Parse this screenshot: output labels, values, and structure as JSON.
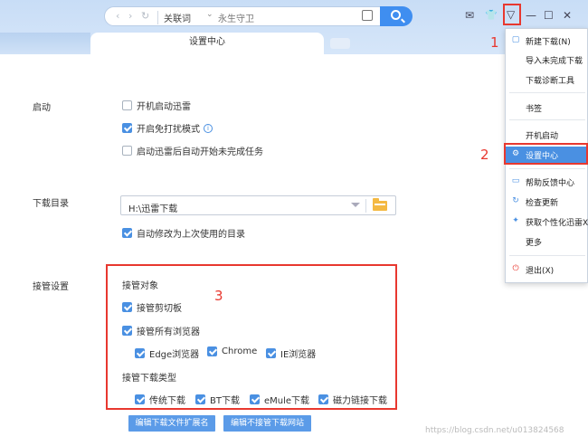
{
  "titlebar": {
    "search_label": "关联词",
    "search_value": "永生守卫",
    "back_icon": "‹",
    "forward_icon": "›",
    "refresh_icon": "↻",
    "dropdown_icon": "⌄",
    "mail_icon": "✉",
    "skin_icon": "👕",
    "menu_icon": "▽",
    "minimize_icon": "—",
    "maximize_icon": "☐",
    "close_icon": "✕"
  },
  "tabs": {
    "active": "设置中心"
  },
  "annotations": {
    "n1": "1",
    "n2": "2",
    "n3": "3"
  },
  "settings": {
    "startup": {
      "label": "启动",
      "options": [
        {
          "text": "开机启动迅雷",
          "checked": false
        },
        {
          "text": "开启免打扰模式",
          "checked": true
        },
        {
          "text": "启动迅雷后自动开始未完成任务",
          "checked": false
        }
      ],
      "info_icon": "i"
    },
    "download_dir": {
      "label": "下载目录",
      "path": "H:\\迅雷下载",
      "auto_modify": {
        "text": "自动修改为上次使用的目录",
        "checked": true
      }
    },
    "takeover": {
      "label": "接管设置",
      "objects_title": "接管对象",
      "clipboard": {
        "text": "接管剪切板",
        "checked": true
      },
      "all_browsers": {
        "text": "接管所有浏览器",
        "checked": true
      },
      "browsers": [
        {
          "text": "Edge浏览器",
          "checked": true
        },
        {
          "text": "Chrome",
          "checked": true
        },
        {
          "text": "IE浏览器",
          "checked": true
        }
      ],
      "types_title": "接管下载类型",
      "types": [
        {
          "text": "传统下载",
          "checked": true
        },
        {
          "text": "BT下载",
          "checked": true
        },
        {
          "text": "eMule下载",
          "checked": true
        },
        {
          "text": "磁力链接下载",
          "checked": true
        }
      ],
      "btn_edit_ext": "编辑下载文件扩展名",
      "btn_edit_sites": "编辑不接管下载网站"
    }
  },
  "menu": {
    "items": [
      {
        "label": "新建下载(N)",
        "icon": "doc-plus-icon",
        "glyph": "▢"
      },
      {
        "label": "导入未完成下载",
        "icon": "",
        "glyph": ""
      },
      {
        "label": "下载诊断工具",
        "icon": "",
        "glyph": ""
      },
      {
        "label": "书签",
        "icon": "",
        "glyph": ""
      },
      {
        "label": "开机启动",
        "icon": "",
        "glyph": ""
      },
      {
        "label": "设置中心",
        "icon": "gear-icon",
        "glyph": "⚙"
      },
      {
        "label": "帮助反馈中心",
        "icon": "chat-icon",
        "glyph": "▭"
      },
      {
        "label": "检查更新",
        "icon": "refresh-icon",
        "glyph": "↻"
      },
      {
        "label": "获取个性化迅雷X",
        "icon": "sparkle-icon",
        "glyph": "✦"
      },
      {
        "label": "更多",
        "icon": "",
        "glyph": ""
      },
      {
        "label": "退出(X)",
        "icon": "power-icon",
        "glyph": "⏻"
      }
    ]
  },
  "watermark": "https://blog.csdn.net/u013824568",
  "colors": {
    "accent": "#4a90e2",
    "annotation_red": "#e8382f",
    "button_blue": "#5b9be8"
  }
}
